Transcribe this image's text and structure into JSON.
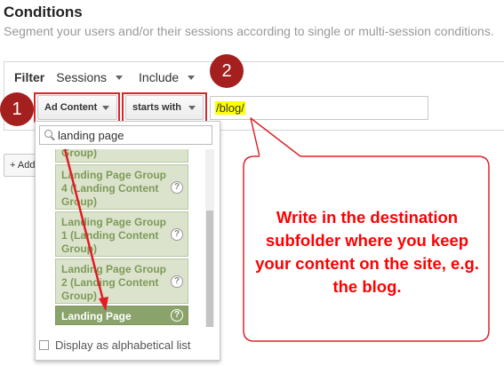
{
  "header": {
    "title": "Conditions",
    "subtitle": "Segment your users and/or their sessions according to single or multi-session conditions."
  },
  "filter": {
    "label": "Filter",
    "scope": "Sessions",
    "mode": "Include"
  },
  "condition": {
    "dimension": "Ad Content",
    "operator": "starts with",
    "value": "/blog/"
  },
  "add_button_label": "+ Add",
  "dropdown": {
    "search_value": "landing page",
    "partial_item": "Group)",
    "items": [
      "Landing Page Group 4 (Landing Content Group)",
      "Landing Page Group 1 (Landing Content Group)",
      "Landing Page Group 2 (Landing Content Group)",
      "Landing Page"
    ],
    "selected_item": "Landing Page",
    "help_glyph": "?",
    "alphabetical_label": "Display as alphabetical list"
  },
  "annotations": {
    "step1": "1",
    "step2": "2",
    "callout": "Write in the destination subfolder where you keep your content on the site, e.g. the blog."
  },
  "colors": {
    "annotation_red": "#d9262b",
    "step_circle": "#a4201f",
    "item_bg": "#dbe3cc",
    "item_text": "#7e9a5a",
    "selected_item_bg": "#8aa36a",
    "highlight": "#ffff00"
  },
  "icons": [
    "search-icon",
    "help-icon",
    "caret-down-icon",
    "checkbox"
  ]
}
